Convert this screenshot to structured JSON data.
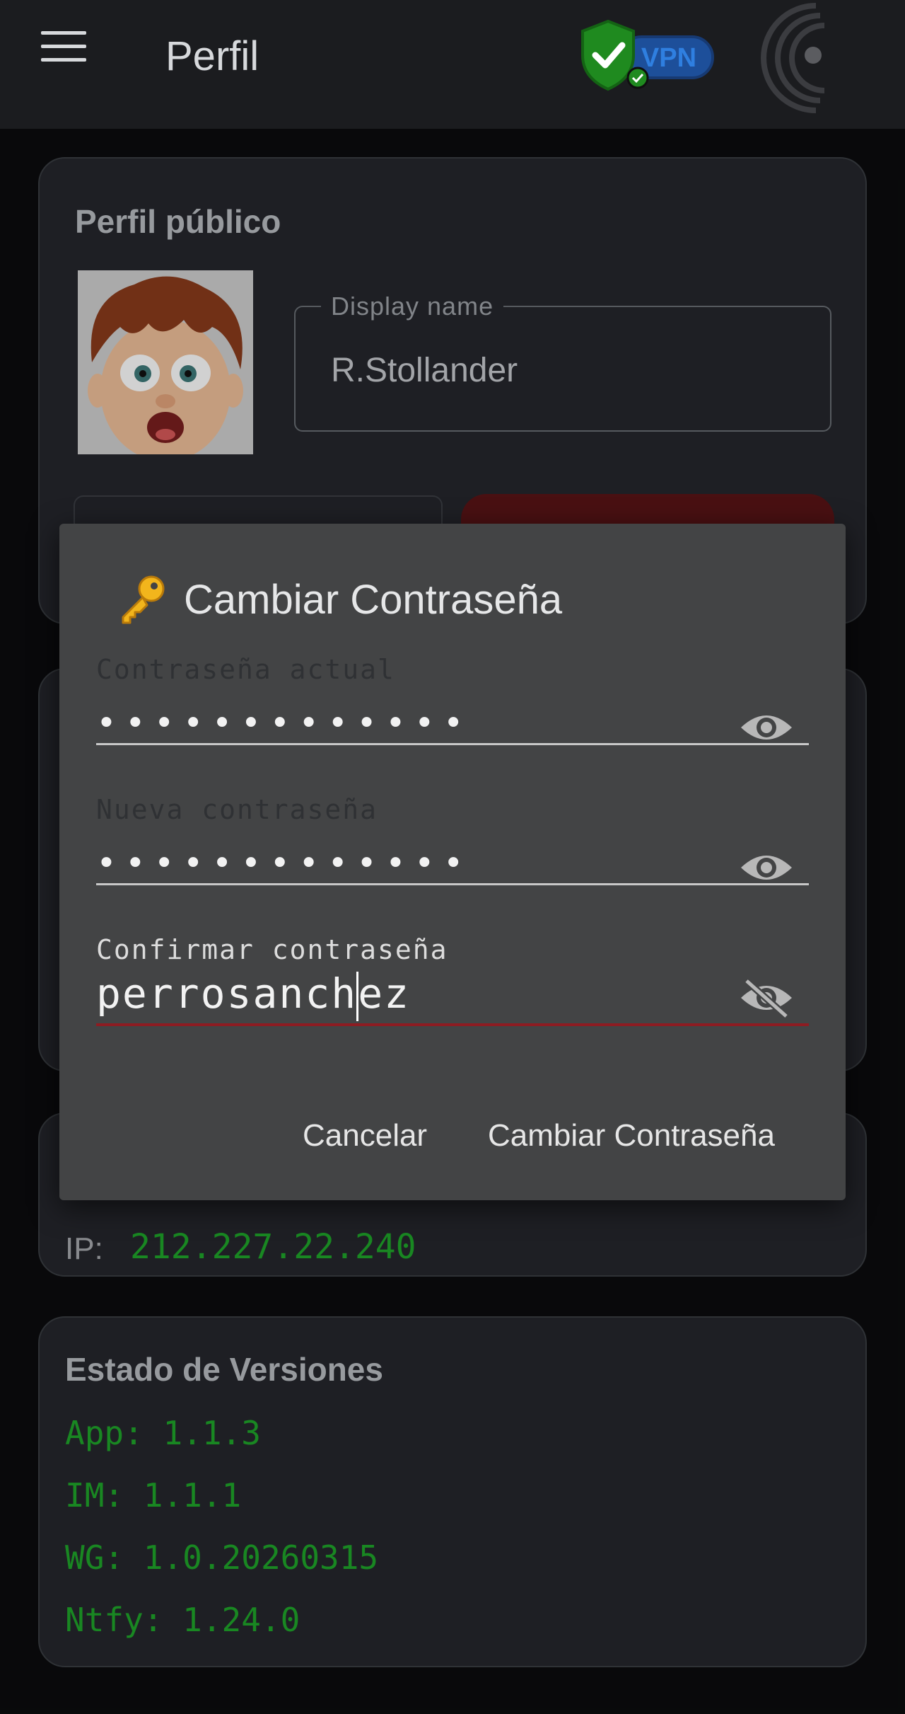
{
  "appbar": {
    "title": "Perfil",
    "vpn_label": "VPN"
  },
  "profile": {
    "section_title": "Perfil público",
    "display_name_label": "Display name",
    "display_name_value": "R.Stollander"
  },
  "network": {
    "ip_label": "IP:",
    "ip_value": "212.227.22.240"
  },
  "versions": {
    "title": "Estado de Versiones",
    "items": [
      "App: 1.1.3",
      "IM: 1.1.1",
      "WG: 1.0.20260315",
      "Ntfy: 1.24.0"
    ]
  },
  "dialog": {
    "title": "Cambiar Contraseña",
    "fields": [
      {
        "label": "Contraseña actual",
        "value": "•••••••••••••"
      },
      {
        "label": "Nueva contraseña",
        "value": "•••••••••••••"
      },
      {
        "label": "Confirmar contraseña",
        "value_before_caret": "perrosanch",
        "value_after_caret": "ez"
      }
    ],
    "cancel_label": "Cancelar",
    "confirm_label": "Cambiar Contraseña"
  },
  "colors": {
    "background": "#0b0c0e",
    "card": "#25272c",
    "dialog": "#434445",
    "accent_green": "#1fa52a",
    "error_red": "#8e1c22",
    "danger_button": "#5a1417"
  }
}
